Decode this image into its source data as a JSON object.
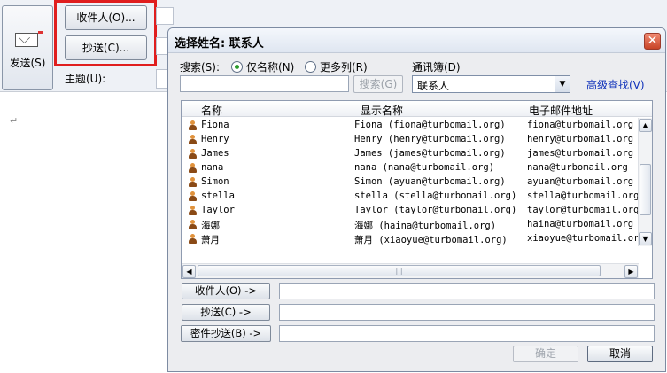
{
  "compose": {
    "send_label": "发送(S)",
    "to_button": "收件人(O)...",
    "cc_button": "抄送(C)...",
    "subject_label": "主题(U):",
    "body_mark": "↵"
  },
  "dialog": {
    "title": "选择姓名: 联系人",
    "close_glyph": "✕",
    "search_label": "搜索(S):",
    "radio_name_only": "仅名称(N)",
    "radio_more_columns": "更多列(R)",
    "addressbook_label": "通讯簿(D)",
    "search_value": "",
    "search_button": "搜索(G)",
    "addressbook_value": "联系人",
    "advanced_search": "高级查找(V)",
    "columns": [
      "名称",
      "显示名称",
      "电子邮件地址"
    ],
    "contacts": [
      {
        "name": "Fiona",
        "display": "Fiona (fiona@turbomail.org)",
        "email": "fiona@turbomail.org"
      },
      {
        "name": "Henry",
        "display": "Henry (henry@turbomail.org)",
        "email": "henry@turbomail.org"
      },
      {
        "name": "James",
        "display": "James (james@turbomail.org)",
        "email": "james@turbomail.org"
      },
      {
        "name": "nana",
        "display": "nana (nana@turbomail.org)",
        "email": "nana@turbomail.org"
      },
      {
        "name": "Simon",
        "display": "Simon (ayuan@turbomail.org)",
        "email": "ayuan@turbomail.org"
      },
      {
        "name": "stella",
        "display": "stella (stella@turbomail.org)",
        "email": "stella@turbomail.org"
      },
      {
        "name": "Taylor",
        "display": "Taylor (taylor@turbomail.org)",
        "email": "taylor@turbomail.org"
      },
      {
        "name": "海娜",
        "display": "海娜 (haina@turbomail.org)",
        "email": "haina@turbomail.org"
      },
      {
        "name": "萧月",
        "display": "萧月 (xiaoyue@turbomail.org)",
        "email": "xiaoyue@turbomail.org"
      }
    ],
    "recipient_to_button": "收件人(O) ->",
    "recipient_cc_button": "抄送(C) ->",
    "recipient_bcc_button": "密件抄送(B) ->",
    "ok_button": "确定",
    "cancel_button": "取消"
  },
  "colors": {
    "highlight": "#e01e1e",
    "link": "#1133bb"
  }
}
